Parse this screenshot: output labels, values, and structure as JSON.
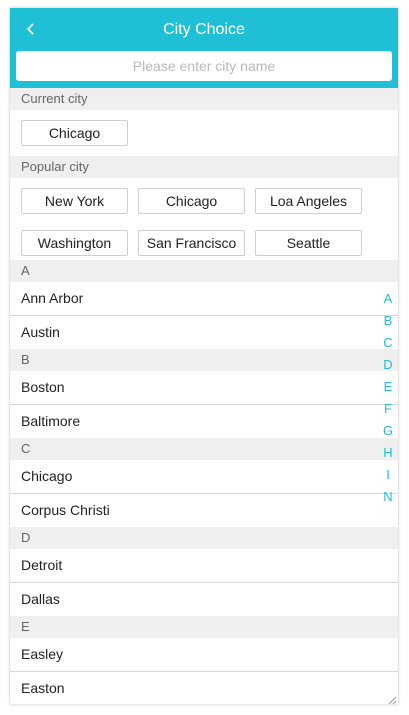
{
  "header": {
    "title": "City Choice",
    "back_icon": "chevron-left-icon",
    "search_placeholder": "Please enter city name",
    "background_color": "#1fbfd6"
  },
  "current": {
    "label": "Current city",
    "city": "Chicago"
  },
  "popular": {
    "label": "Popular city",
    "cities": [
      "New York",
      "Chicago",
      "Loa Angeles",
      "Washington",
      "San Francisco",
      "Seattle"
    ]
  },
  "groups": [
    {
      "letter": "A",
      "cities": [
        "Ann Arbor",
        "Austin"
      ]
    },
    {
      "letter": "B",
      "cities": [
        "Boston",
        "Baltimore"
      ]
    },
    {
      "letter": "C",
      "cities": [
        "Chicago",
        "Corpus Christi"
      ]
    },
    {
      "letter": "D",
      "cities": [
        "Detroit",
        "Dallas"
      ]
    },
    {
      "letter": "E",
      "cities": [
        "Easley",
        "Easton"
      ]
    }
  ],
  "index_letters": [
    "A",
    "B",
    "C",
    "D",
    "E",
    "F",
    "G",
    "H",
    "I",
    "N"
  ],
  "accent_color": "#1fbfd6"
}
